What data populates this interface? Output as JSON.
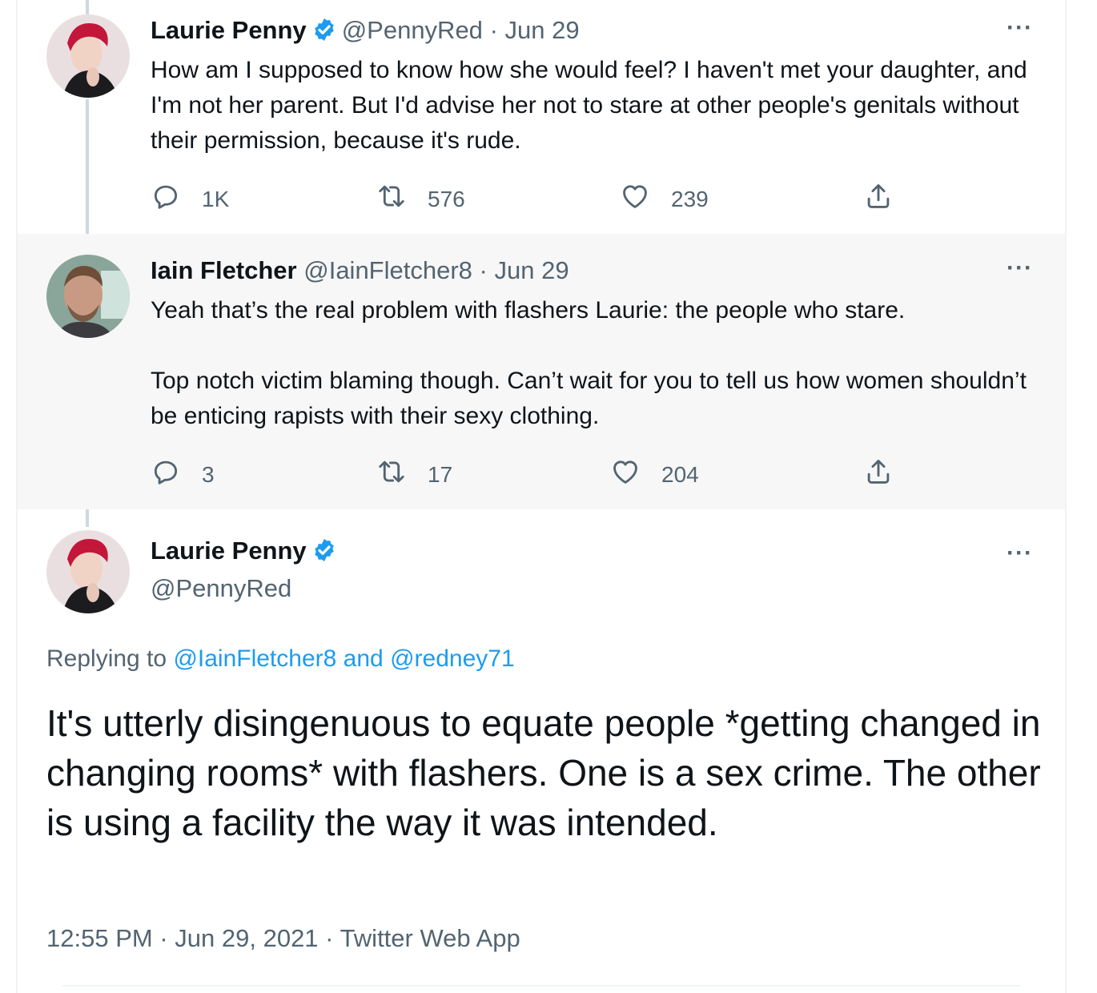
{
  "tweets": [
    {
      "name": "Laurie Penny",
      "handle": "@PennyRed",
      "sep": "·",
      "date": "Jun 29",
      "verified": true,
      "text": "How am I supposed to know how she would feel? I haven't met your daughter, and I'm not her parent. But I'd advise her not to stare at other people's genitals without their permission, because it's rude.",
      "replies": "1K",
      "retweets": "576",
      "likes": "239"
    },
    {
      "name": "Iain Fletcher",
      "handle": "@IainFletcher8",
      "sep": "·",
      "date": "Jun 29",
      "verified": false,
      "text_p1": "Yeah that’s the real problem with flashers Laurie: the people who stare.",
      "text_p2": "Top notch victim blaming though. Can’t wait for you to tell us how women shouldn’t be enticing rapists with their sexy clothing.",
      "replies": "3",
      "retweets": "17",
      "likes": "204"
    }
  ],
  "focal": {
    "name": "Laurie Penny",
    "handle": "@PennyRed",
    "replying_label": "Replying to",
    "replying_user1": "@IainFletcher8",
    "replying_and": "and",
    "replying_user2": "@redney71",
    "text": "It's utterly disingenuous to equate people *getting changed in changing rooms* with flashers. One is a sex crime. The other is using a facility the way it was intended.",
    "time": "12:55 PM",
    "date": "Jun 29, 2021",
    "source": "Twitter Web App",
    "sep": "·"
  },
  "more_label": "···",
  "icons": [
    "reply-icon",
    "retweet-icon",
    "like-icon",
    "share-icon",
    "verified-badge-icon",
    "more-icon"
  ],
  "colors": {
    "verified": "#1d9bf0",
    "link": "#1d9bf0",
    "muted": "#536471",
    "highlight_bg": "#f7f7f7"
  }
}
